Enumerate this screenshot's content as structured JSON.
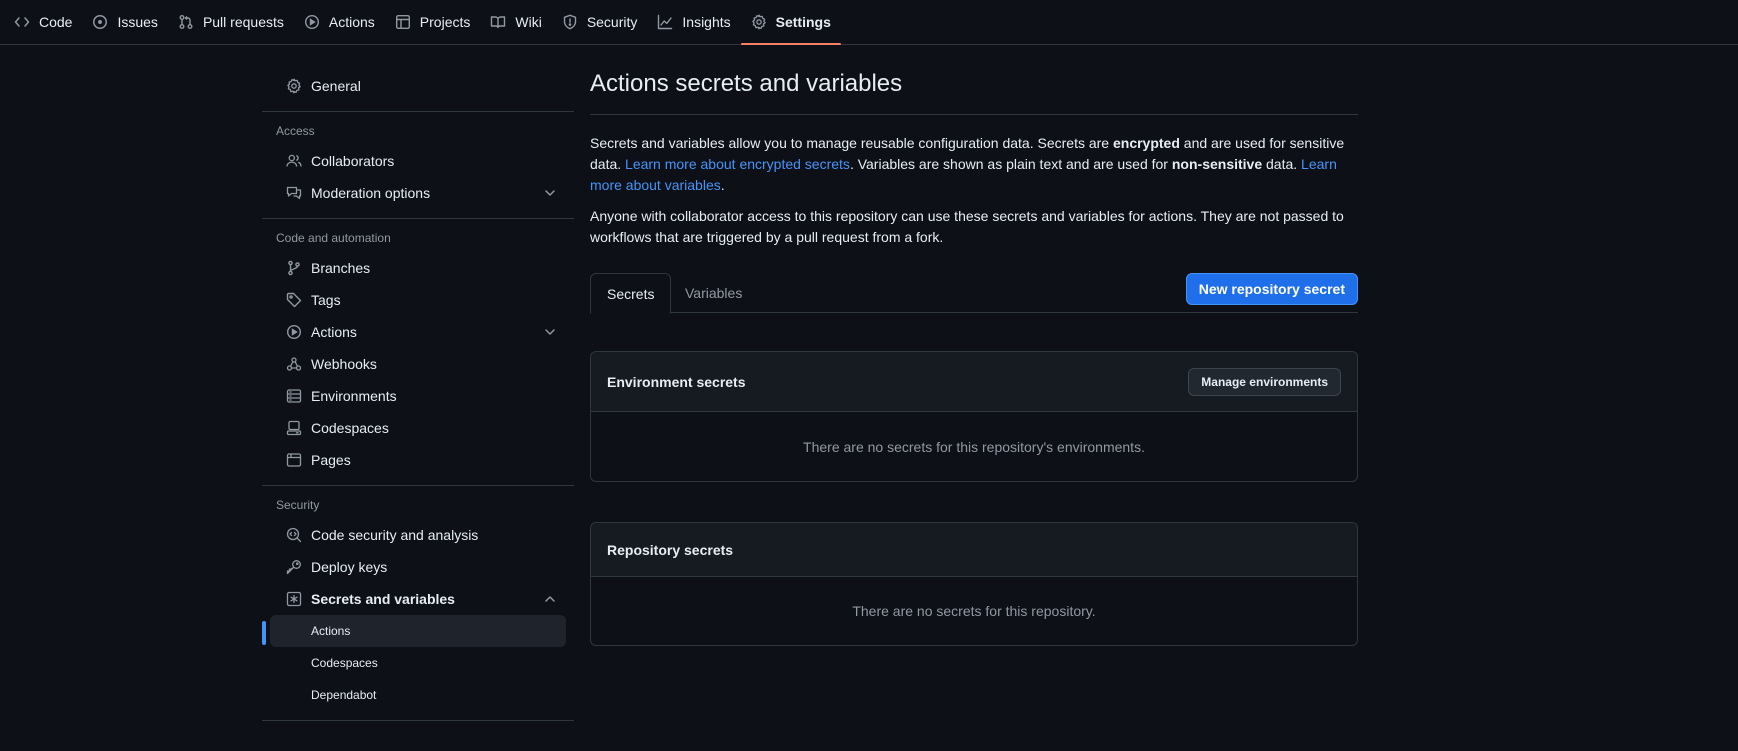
{
  "repo_nav": {
    "items": [
      {
        "label": "Code",
        "icon": "code-icon"
      },
      {
        "label": "Issues",
        "icon": "issue-opened-icon"
      },
      {
        "label": "Pull requests",
        "icon": "git-pull-request-icon"
      },
      {
        "label": "Actions",
        "icon": "play-icon"
      },
      {
        "label": "Projects",
        "icon": "table-icon"
      },
      {
        "label": "Wiki",
        "icon": "book-icon"
      },
      {
        "label": "Security",
        "icon": "shield-icon"
      },
      {
        "label": "Insights",
        "icon": "graph-icon"
      },
      {
        "label": "Settings",
        "icon": "gear-icon"
      }
    ],
    "selected": "Settings"
  },
  "sidebar": {
    "general": "General",
    "access_heading": "Access",
    "access": [
      "Collaborators",
      "Moderation options"
    ],
    "code_heading": "Code and automation",
    "code": [
      "Branches",
      "Tags",
      "Actions",
      "Webhooks",
      "Environments",
      "Codespaces",
      "Pages"
    ],
    "security_heading": "Security",
    "security": [
      "Code security and analysis",
      "Deploy keys",
      "Secrets and variables"
    ],
    "secrets_sub": [
      "Actions",
      "Codespaces",
      "Dependabot"
    ],
    "current_sub": "Actions"
  },
  "main": {
    "title": "Actions secrets and variables",
    "intro": {
      "p1_a": "Secrets and variables allow you to manage reusable configuration data. Secrets are ",
      "p1_b": "encrypted",
      "p1_c": " and are used for sensitive data. ",
      "p1_link1": "Learn more about encrypted secrets",
      "p1_d": ". Variables are shown as plain text and are used for ",
      "p1_e": "non-sensitive",
      "p1_f": " data. ",
      "p1_link2": "Learn more about variables",
      "p1_g": ".",
      "p2": "Anyone with collaborator access to this repository can use these secrets and variables for actions. They are not passed to workflows that are triggered by a pull request from a fork."
    },
    "tabs": [
      "Secrets",
      "Variables"
    ],
    "active_tab": "Secrets",
    "new_secret_button": "New repository secret",
    "env_secrets": {
      "title": "Environment secrets",
      "button": "Manage environments",
      "empty": "There are no secrets for this repository's environments."
    },
    "repo_secrets": {
      "title": "Repository secrets",
      "empty": "There are no secrets for this repository."
    }
  },
  "colors": {
    "background": "#0d1117",
    "border": "#30363d",
    "accent_link": "#4493f8",
    "primary_button": "#1f6feb",
    "selected_underline": "#f78166"
  }
}
